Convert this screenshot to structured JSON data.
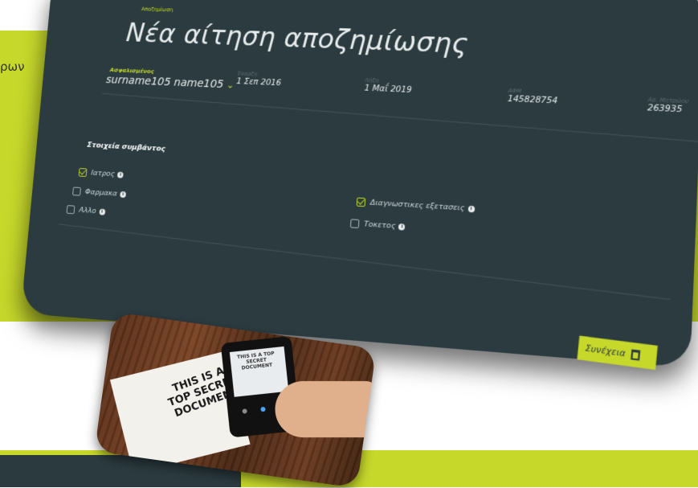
{
  "background_text": "ρων",
  "form": {
    "breadcrumb": "Αποζημίωση",
    "title": "Νέα αίτηση αποζημίωσης",
    "insured_label": "Ασφαλισμένος",
    "insured_name": "surname105 name105",
    "meta": [
      {
        "label": "Έναρξη",
        "value": "1 Σεπ 2016"
      },
      {
        "label": "Λήξη",
        "value": "1 Μαΐ 2019"
      },
      {
        "label": "ΑΦΜ",
        "value": "145828754"
      },
      {
        "label": "Αρ. Μητρώου",
        "value": "263935"
      }
    ],
    "section_title": "Στοιχεία συμβάντος",
    "checkboxes_left": [
      {
        "label": "Ιατρος",
        "checked": true
      },
      {
        "label": "Φαρμακα",
        "checked": false
      },
      {
        "label": "Αλλο",
        "checked": false
      }
    ],
    "checkboxes_right": [
      {
        "label": "Διαγνωστικες εξετασεις",
        "checked": true
      },
      {
        "label": "Τοκετος",
        "checked": false
      }
    ],
    "continue_label": "Συνέχεια"
  },
  "photo": {
    "paper_text": "THIS IS A TOP SECRET DOCUMENT",
    "screen_text": "THIS IS A TOP SECRET DOCUMENT"
  },
  "colors": {
    "lime": "#c6d82a",
    "card": "#2b3b40"
  }
}
